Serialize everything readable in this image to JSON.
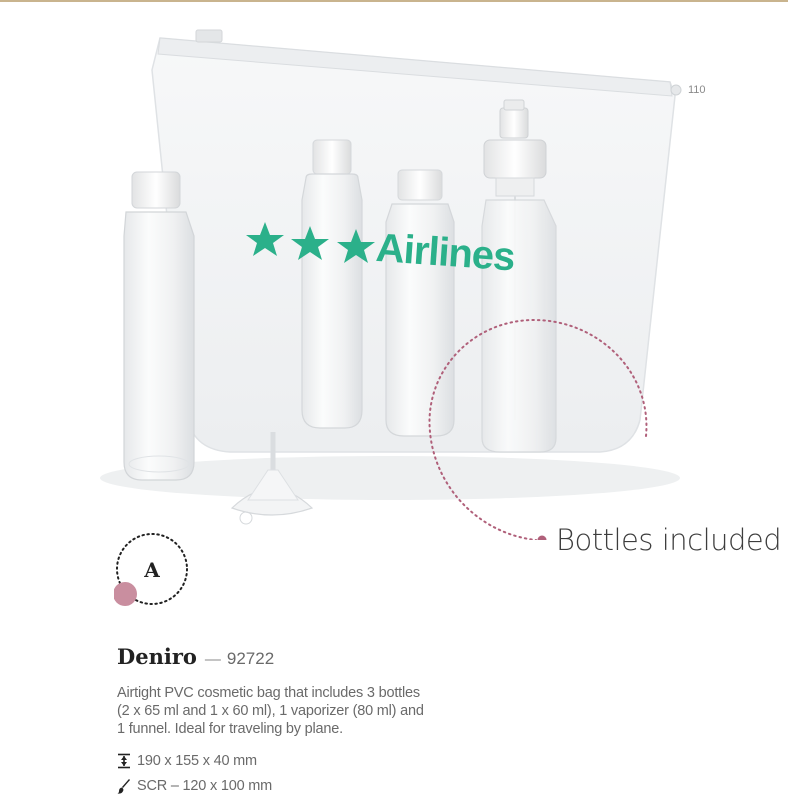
{
  "page": {
    "page_number": "110"
  },
  "product_image": {
    "brand_print": "Airlines",
    "brand_color": "#2bb08a",
    "stars": 3
  },
  "callout": {
    "text": "Bottles included",
    "color": "#b0607a"
  },
  "badge": {
    "letter": "A",
    "dot_color": "#c98e9f"
  },
  "product": {
    "name": "Deniro",
    "dash": "—",
    "code": "92722",
    "description_lines": [
      "Airtight PVC cosmetic bag that includes 3 bottles",
      "(2 x 65 ml and 1 x 60 ml), 1 vaporizer (80 ml) and",
      "1 funnel.  Ideal for traveling by plane."
    ],
    "dimensions": "190 x 155 x 40 mm",
    "dimensions_icon": "height-arrows-icon",
    "print_area": "SCR – 120 x 100 mm",
    "print_icon": "brush-icon"
  }
}
